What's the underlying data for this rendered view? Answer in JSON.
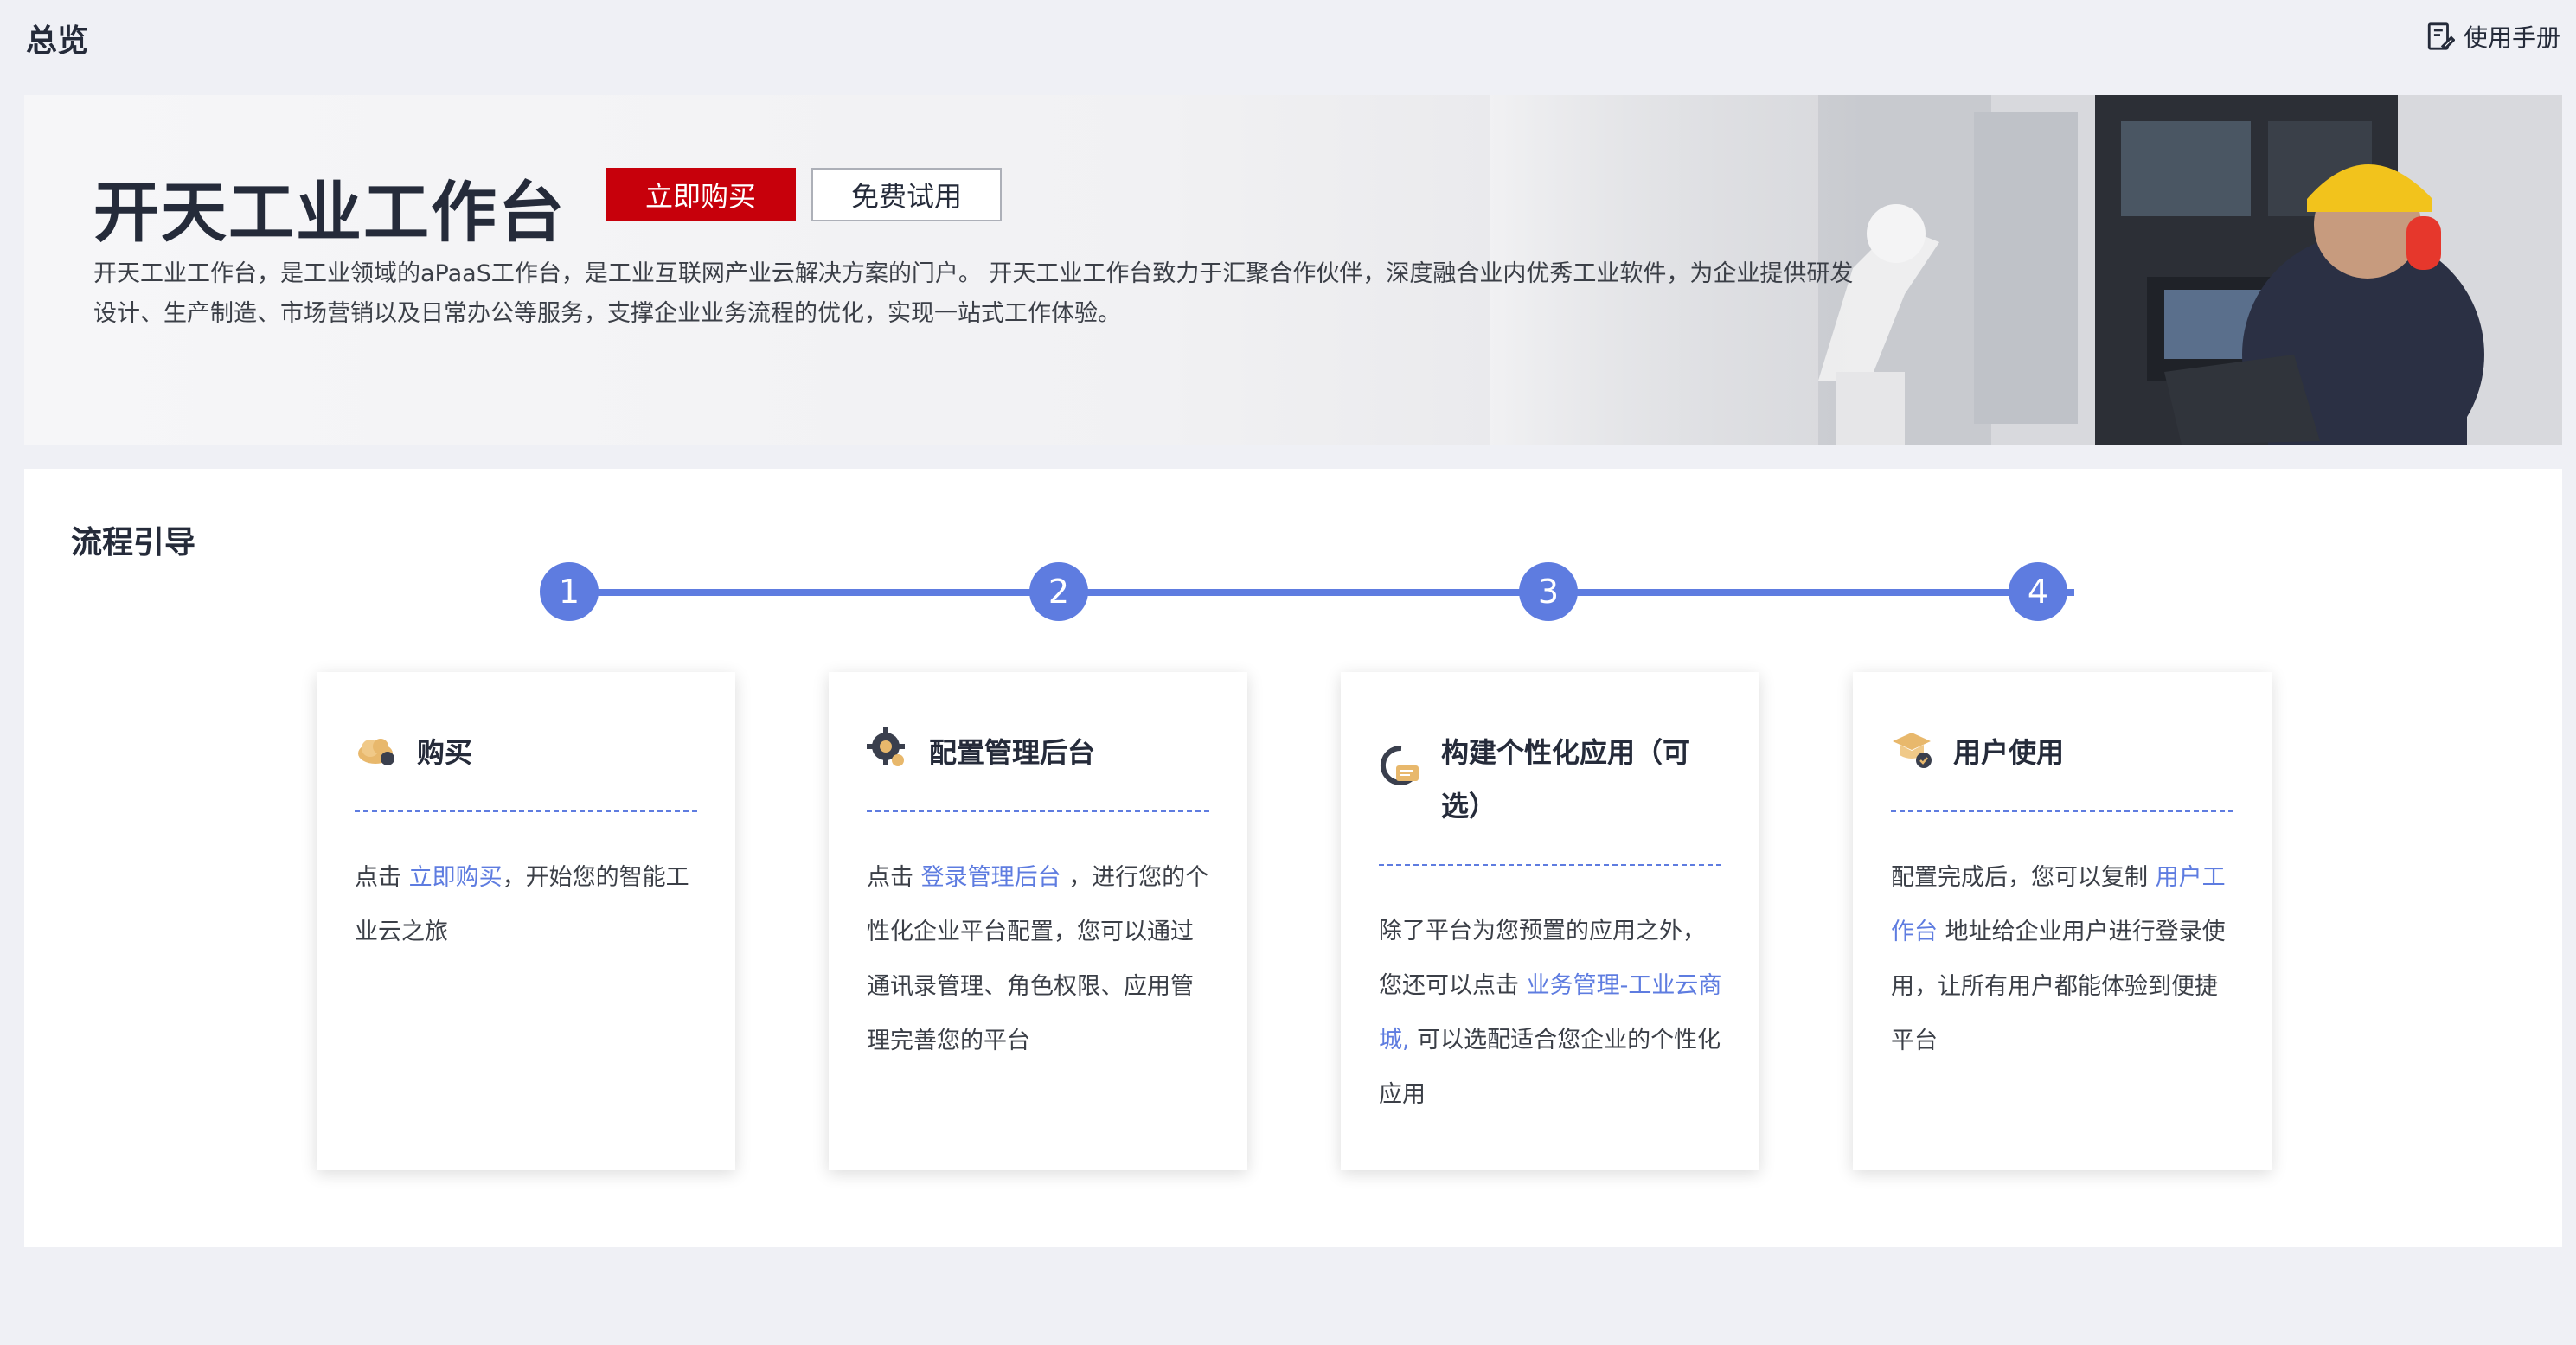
{
  "header": {
    "title": "总览",
    "manual_label": "使用手册"
  },
  "banner": {
    "title": "开天工业工作台",
    "buy_label": "立即购买",
    "trial_label": "免费试用",
    "description": "开天工业工作台，是工业领域的aPaaS工作台，是工业互联网产业云解决方案的门户。 开天工业工作台致力于汇聚合作伙伴，深度融合业内优秀工业软件，为企业提供研发设计、生产制造、市场营销以及日常办公等服务，支撑企业业务流程的优化，实现一站式工作体验。"
  },
  "flow": {
    "title": "流程引导",
    "steps": [
      "1",
      "2",
      "3",
      "4"
    ],
    "cards": [
      {
        "title": "购买",
        "text_before": "点击 ",
        "link": "立即购买",
        "text_after": "，开始您的智能工业云之旅"
      },
      {
        "title": "配置管理后台",
        "text_before": "点击 ",
        "link": "登录管理后台",
        "text_after": " ，进行您的个性化企业平台配置，您可以通过通讯录管理、角色权限、应用管理完善您的平台"
      },
      {
        "title": "构建个性化应用（可选）",
        "text_before": "除了平台为您预置的应用之外，您还可以点击 ",
        "link": "业务管理-工业云商城,",
        "text_after": " 可以选配适合您企业的个性化应用"
      },
      {
        "title": "用户使用",
        "text_before": "配置完成后，您可以复制 ",
        "link": "用户工作台",
        "text_after": " 地址给企业用户进行登录使用，让所有用户都能体验到便捷平台"
      }
    ]
  },
  "colors": {
    "accent": "#5e7ce0",
    "brand_red": "#c7000b",
    "page_bg": "#eff0f5"
  }
}
